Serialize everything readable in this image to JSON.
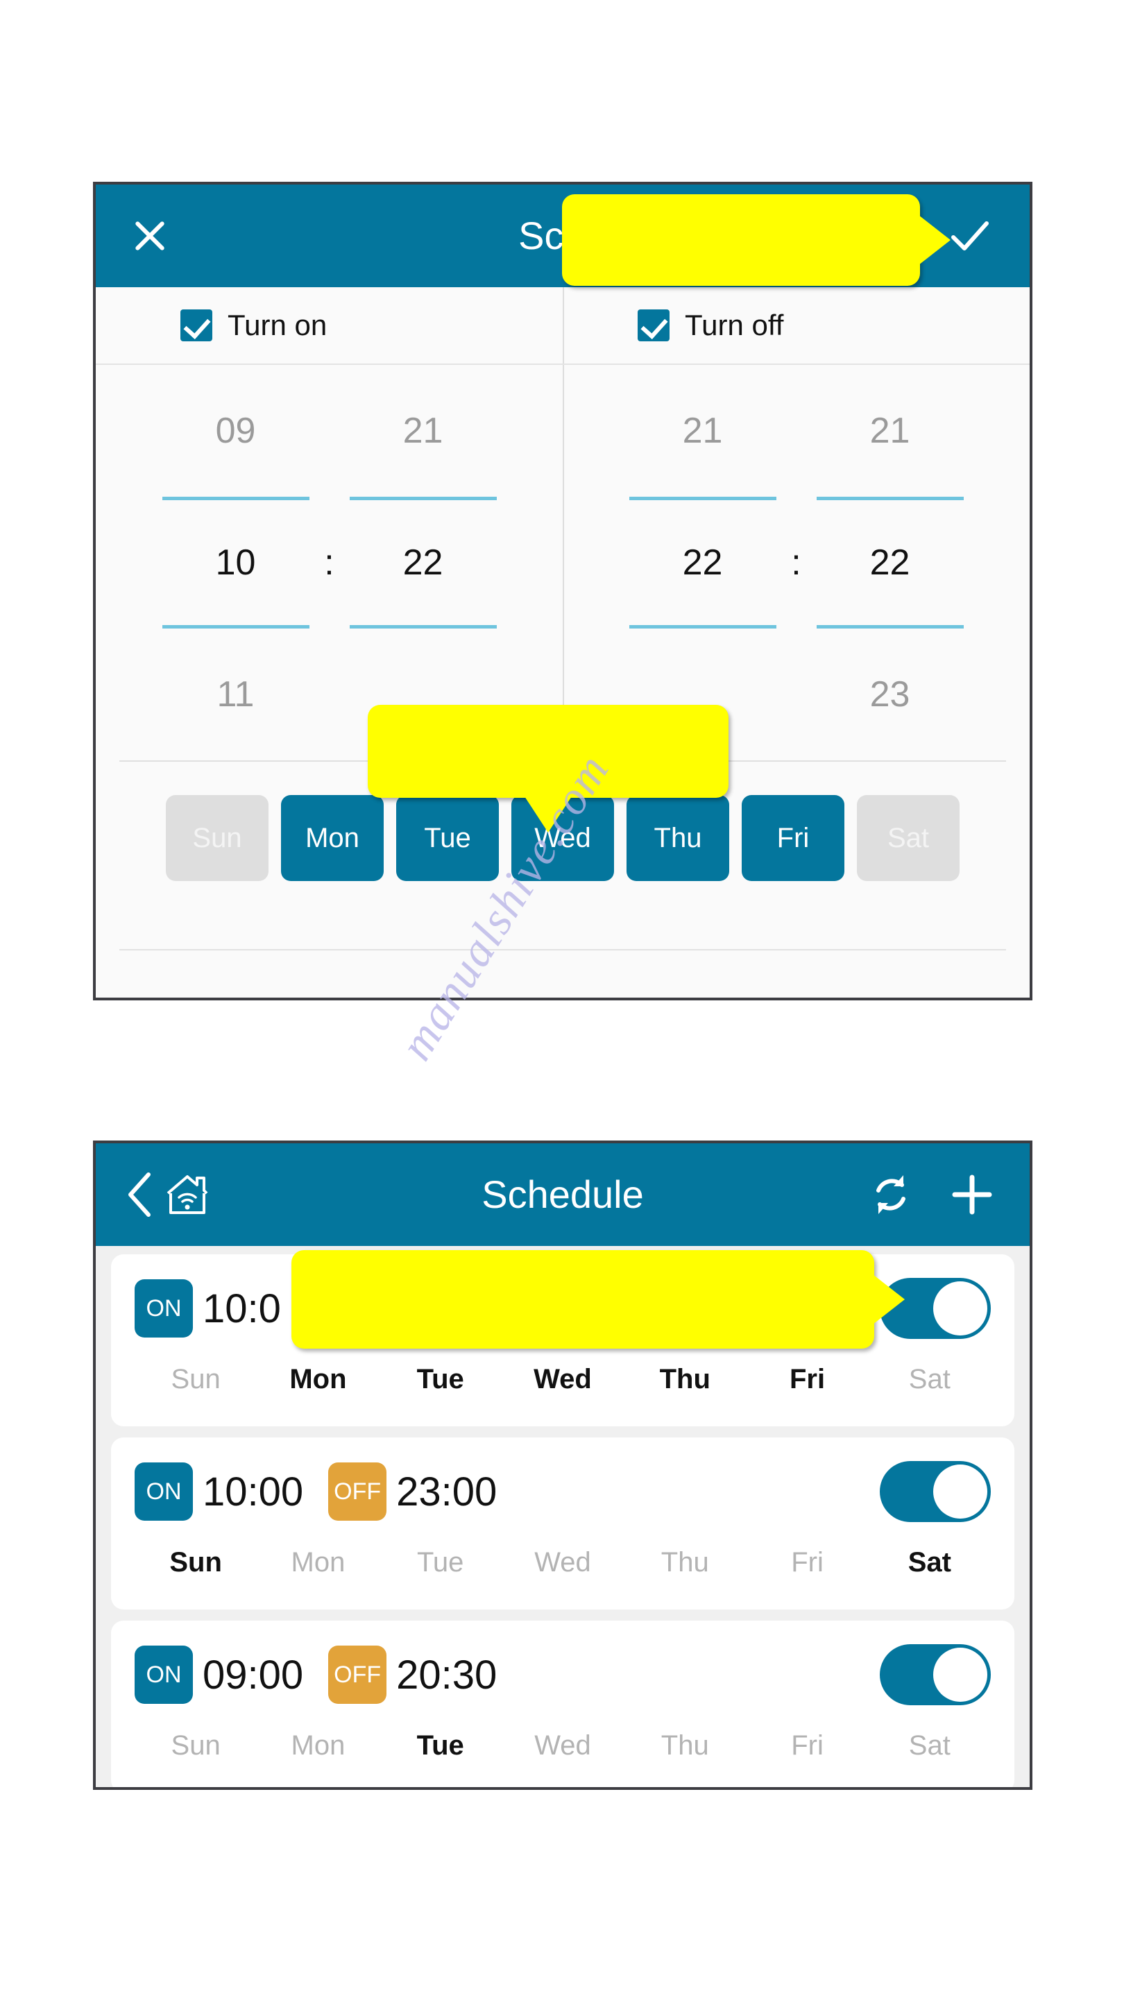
{
  "edit_screen": {
    "title": "Sche",
    "close_icon": "close-icon",
    "confirm_icon": "check-icon",
    "turn_on": {
      "label": "Turn on",
      "checked": true
    },
    "turn_off": {
      "label": "Turn off",
      "checked": true
    },
    "picker": {
      "on_hour": {
        "prev": "09",
        "selected": "10",
        "next": "11"
      },
      "on_minute": {
        "prev": "21",
        "selected": "22",
        "next": ""
      },
      "off_hour": {
        "prev": "21",
        "selected": "22",
        "next": ""
      },
      "off_minute": {
        "prev": "21",
        "selected": "22",
        "next": "23"
      },
      "separator": ":"
    },
    "days": [
      {
        "label": "Sun",
        "active": false
      },
      {
        "label": "Mon",
        "active": true
      },
      {
        "label": "Tue",
        "active": true
      },
      {
        "label": "Wed",
        "active": true
      },
      {
        "label": "Thu",
        "active": true
      },
      {
        "label": "Fri",
        "active": true
      },
      {
        "label": "Sat",
        "active": false
      }
    ]
  },
  "list_screen": {
    "title": "Schedule",
    "back_icon": "back-chevron-icon",
    "home_icon": "home-wifi-icon",
    "refresh_icon": "refresh-icon",
    "add_icon": "plus-icon",
    "rows": [
      {
        "on_badge": "ON",
        "on_time": "10:0",
        "off_badge": "",
        "off_time": "",
        "toggle_on": true,
        "days": [
          {
            "label": "Sun",
            "active": false
          },
          {
            "label": "Mon",
            "active": true
          },
          {
            "label": "Tue",
            "active": true
          },
          {
            "label": "Wed",
            "active": true
          },
          {
            "label": "Thu",
            "active": true
          },
          {
            "label": "Fri",
            "active": true
          },
          {
            "label": "Sat",
            "active": false
          }
        ]
      },
      {
        "on_badge": "ON",
        "on_time": "10:00",
        "off_badge": "OFF",
        "off_time": "23:00",
        "toggle_on": true,
        "days": [
          {
            "label": "Sun",
            "active": true
          },
          {
            "label": "Mon",
            "active": false
          },
          {
            "label": "Tue",
            "active": false
          },
          {
            "label": "Wed",
            "active": false
          },
          {
            "label": "Thu",
            "active": false
          },
          {
            "label": "Fri",
            "active": false
          },
          {
            "label": "Sat",
            "active": true
          }
        ]
      },
      {
        "on_badge": "ON",
        "on_time": "09:00",
        "off_badge": "OFF",
        "off_time": "20:30",
        "toggle_on": true,
        "days": [
          {
            "label": "Sun",
            "active": false
          },
          {
            "label": "Mon",
            "active": false
          },
          {
            "label": "Tue",
            "active": true
          },
          {
            "label": "Wed",
            "active": false
          },
          {
            "label": "Thu",
            "active": false
          },
          {
            "label": "Fri",
            "active": false
          },
          {
            "label": "Sat",
            "active": false
          }
        ]
      }
    ]
  },
  "callouts": {
    "title_callout": "",
    "minute_callout": "",
    "time_callout": ""
  },
  "watermark": {
    "text": "manualshive.com"
  },
  "colors": {
    "brand_teal": "#04769d",
    "accent_orange": "#e2a33a",
    "callout_yellow": "#ffff00",
    "picker_underline": "#6ec4de",
    "chip_inactive": "#dedede"
  }
}
